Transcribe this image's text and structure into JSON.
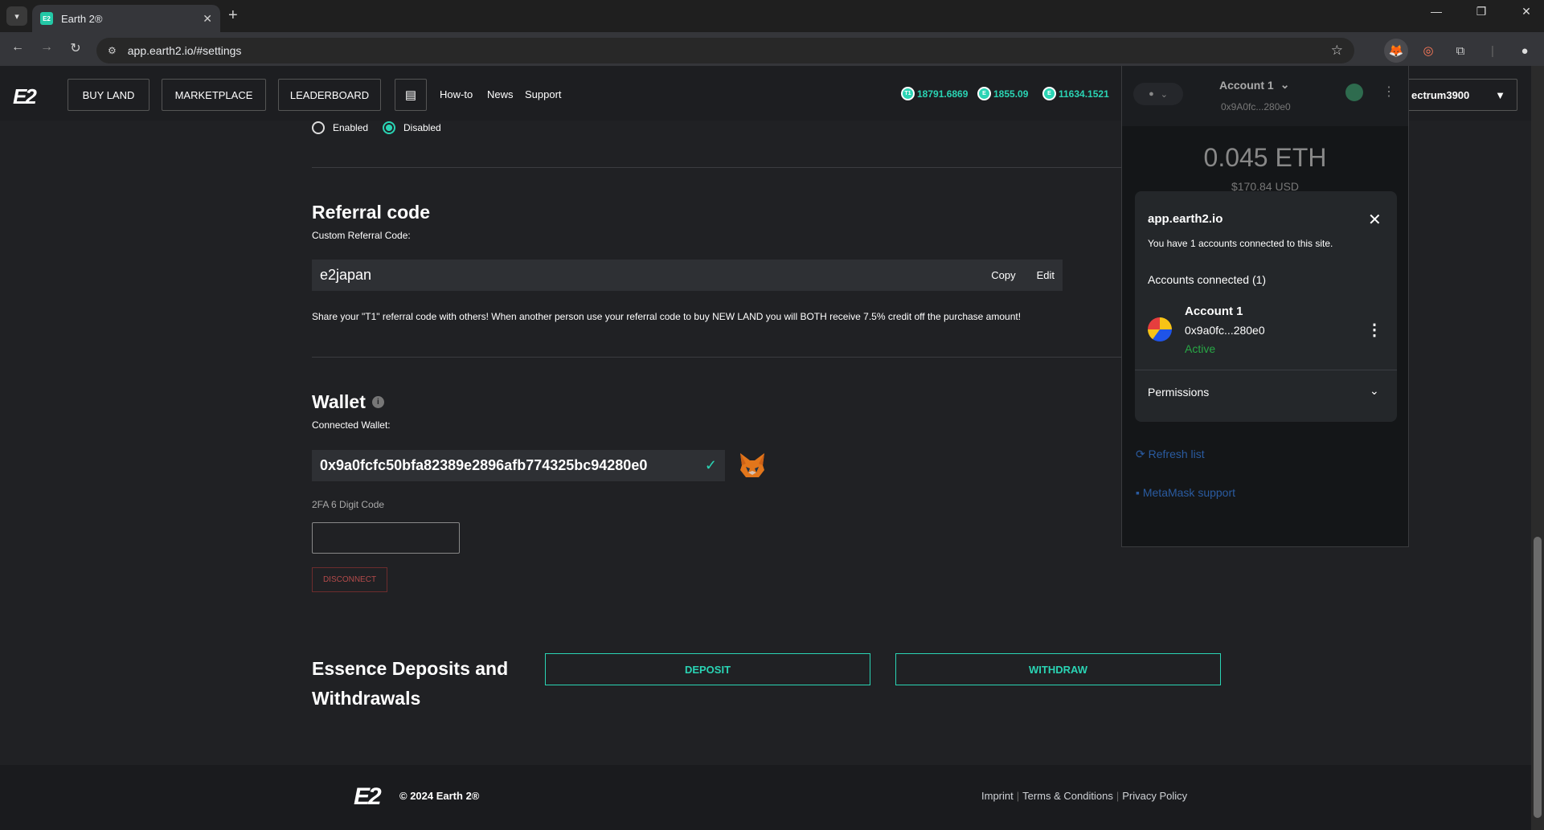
{
  "browser": {
    "tab_title": "Earth 2®",
    "tab_favicon": "E2",
    "url": "app.earth2.io/#settings",
    "win_minimize": "—",
    "win_restore": "❐",
    "win_close": "✕"
  },
  "header": {
    "logo": "E2",
    "buttons": {
      "buy_land": "BUY LAND",
      "marketplace": "MARKETPLACE",
      "leaderboard": "LEADERBOARD"
    },
    "links": {
      "howto": "How-to",
      "news": "News",
      "support": "Support"
    },
    "balances": [
      {
        "icon": "T1",
        "value": "18791.6869"
      },
      {
        "icon": "E",
        "value": "1855.09"
      },
      {
        "icon": "E",
        "value": "11634.1521"
      }
    ],
    "username": "ectrum3900"
  },
  "settings": {
    "radio": {
      "enabled": "Enabled",
      "disabled": "Disabled",
      "selected": "disabled"
    },
    "referral": {
      "title": "Referral code",
      "subtitle": "Custom Referral Code:",
      "code": "e2japan",
      "copy": "Copy",
      "edit": "Edit",
      "description": "Share your \"T1\" referral code with others! When another person use your referral code to buy NEW LAND you will BOTH receive 7.5% credit off the purchase amount!"
    },
    "wallet": {
      "title": "Wallet",
      "subtitle": "Connected Wallet:",
      "address": "0x9a0fcfc50bfa82389e2896afb774325bc94280e0",
      "twofa_label": "2FA 6 Digit Code",
      "disconnect": "DISCONNECT"
    },
    "essence": {
      "title": "Essence Deposits and Withdrawals",
      "deposit": "DEPOSIT",
      "withdraw": "WITHDRAW"
    }
  },
  "footer": {
    "logo": "E2",
    "copyright": "© 2024 Earth 2®",
    "links": [
      "Imprint",
      "Terms & Conditions",
      "Privacy Policy"
    ]
  },
  "metamask": {
    "account_name": "Account 1",
    "account_short": "0x9A0fc...280e0",
    "balance": "0.045 ETH",
    "balance_usd": "$170.84 USD",
    "refresh": "Refresh list",
    "support": "MetaMask support",
    "modal": {
      "site": "app.earth2.io",
      "connected_msg": "You have 1 accounts connected to this site.",
      "accounts_heading": "Accounts connected (1)",
      "account": {
        "name": "Account 1",
        "address": "0x9a0fc...280e0",
        "status": "Active"
      },
      "permissions": "Permissions"
    }
  }
}
